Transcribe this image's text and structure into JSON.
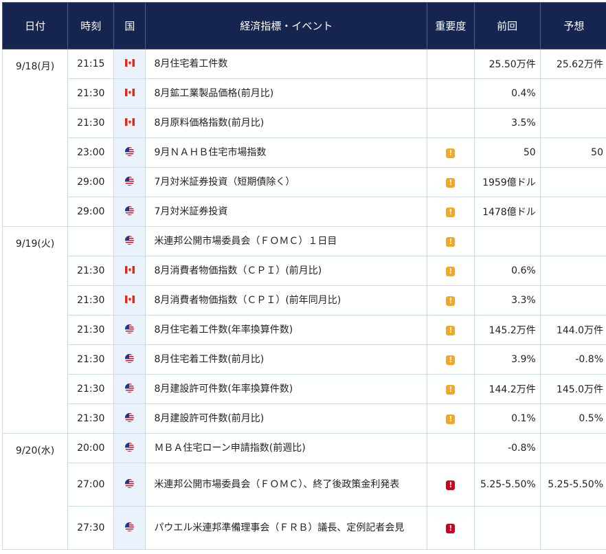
{
  "headers": [
    "日付",
    "時刻",
    "国",
    "経済指標・イベント",
    "重要度",
    "前回",
    "予想"
  ],
  "icons": {
    "canada": "canada-flag-icon",
    "us": "us-flag-icon",
    "importance": "exclamation-icon"
  },
  "colors": {
    "header_bg": "#16254f",
    "flag_col_bg": "#eaf3fb",
    "importance_mid": "#f5a623",
    "importance_high": "#d0021b"
  },
  "rows": [
    {
      "date": "9/18(月)",
      "time": "21:15",
      "country": "canada",
      "event": "8月住宅着工件数",
      "importance": "",
      "prev": "25.50万件",
      "forecast": "25.62万件"
    },
    {
      "date": "",
      "time": "21:30",
      "country": "canada",
      "event": "8月鉱工業製品価格(前月比)",
      "importance": "",
      "prev": "0.4%",
      "forecast": ""
    },
    {
      "date": "",
      "time": "21:30",
      "country": "canada",
      "event": "8月原料価格指数(前月比)",
      "importance": "",
      "prev": "3.5%",
      "forecast": ""
    },
    {
      "date": "",
      "time": "23:00",
      "country": "us",
      "event": "9月ＮＡＨＢ住宅市場指数",
      "importance": "mid",
      "prev": "50",
      "forecast": "50"
    },
    {
      "date": "",
      "time": "29:00",
      "country": "us",
      "event": "7月対米証券投資（短期債除く）",
      "importance": "mid",
      "prev": "1959億ドル",
      "forecast": ""
    },
    {
      "date": "",
      "time": "29:00",
      "country": "us",
      "event": "7月対米証券投資",
      "importance": "mid",
      "prev": "1478億ドル",
      "forecast": ""
    },
    {
      "date": "9/19(火)",
      "time": "",
      "country": "us",
      "event": "米連邦公開市場委員会（ＦＯＭＣ）１日目",
      "importance": "mid",
      "prev": "",
      "forecast": ""
    },
    {
      "date": "",
      "time": "21:30",
      "country": "canada",
      "event": "8月消費者物価指数（ＣＰＩ）(前月比)",
      "importance": "mid",
      "prev": "0.6%",
      "forecast": ""
    },
    {
      "date": "",
      "time": "21:30",
      "country": "canada",
      "event": "8月消費者物価指数（ＣＰＩ）(前年同月比)",
      "importance": "mid",
      "prev": "3.3%",
      "forecast": ""
    },
    {
      "date": "",
      "time": "21:30",
      "country": "us",
      "event": "8月住宅着工件数(年率換算件数)",
      "importance": "mid",
      "prev": "145.2万件",
      "forecast": "144.0万件"
    },
    {
      "date": "",
      "time": "21:30",
      "country": "us",
      "event": "8月住宅着工件数(前月比)",
      "importance": "mid",
      "prev": "3.9%",
      "forecast": "-0.8%"
    },
    {
      "date": "",
      "time": "21:30",
      "country": "us",
      "event": "8月建設許可件数(年率換算件数)",
      "importance": "mid",
      "prev": "144.2万件",
      "forecast": "145.0万件"
    },
    {
      "date": "",
      "time": "21:30",
      "country": "us",
      "event": "8月建設許可件数(前月比)",
      "importance": "mid",
      "prev": "0.1%",
      "forecast": "0.5%"
    },
    {
      "date": "9/20(水)",
      "time": "20:00",
      "country": "us",
      "event": "ＭＢＡ住宅ローン申請指数(前週比)",
      "importance": "",
      "prev": "-0.8%",
      "forecast": ""
    },
    {
      "date": "",
      "time": "27:00",
      "country": "us",
      "event": "米連邦公開市場委員会（ＦＯＭＣ）、終了後政策金利発表",
      "importance": "high",
      "prev": "5.25-5.50%",
      "forecast": "5.25-5.50%"
    },
    {
      "date": "",
      "time": "27:30",
      "country": "us",
      "event": "パウエル米連邦準備理事会（ＦＲＢ）議長、定例記者会見",
      "importance": "high",
      "prev": "",
      "forecast": ""
    }
  ]
}
